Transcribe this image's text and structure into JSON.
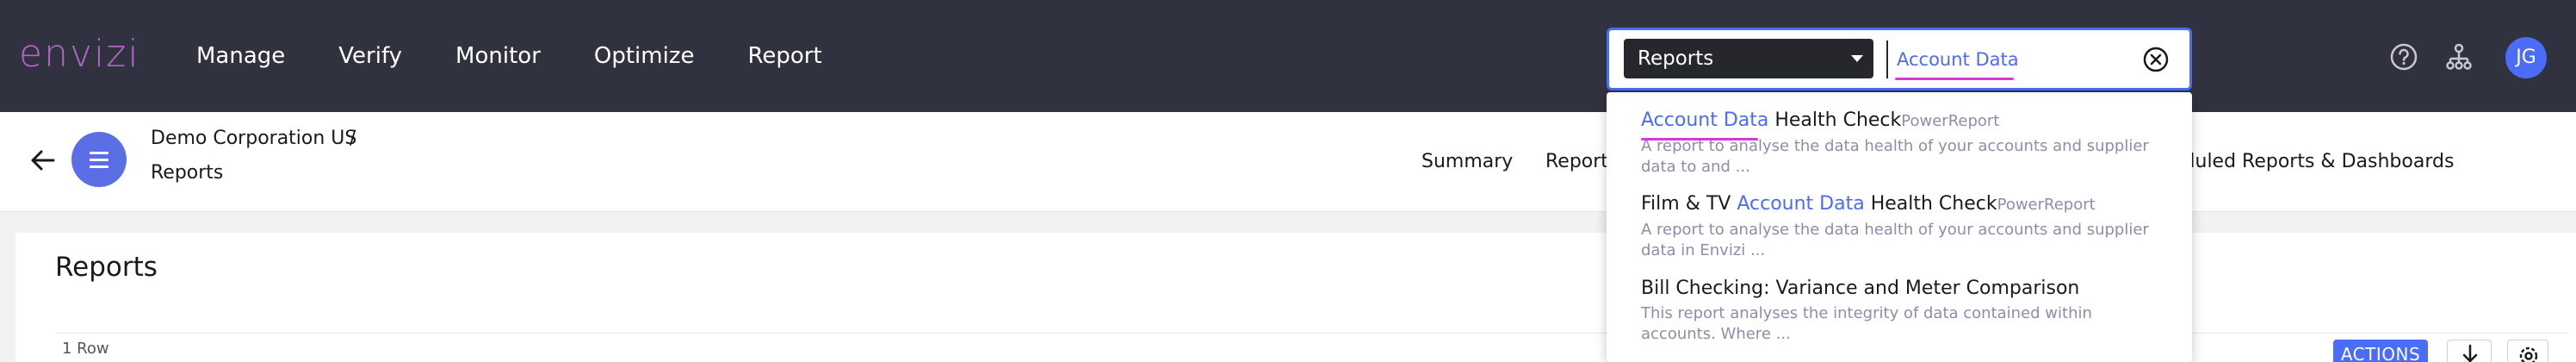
{
  "topbar": {
    "logo": "envizi",
    "nav": [
      "Manage",
      "Verify",
      "Monitor",
      "Optimize",
      "Report"
    ],
    "search": {
      "scope": "Reports",
      "query": "Account Data"
    },
    "avatar_initials": "JG",
    "icons": [
      "help-icon",
      "org-tree-icon",
      "clear-search-icon"
    ]
  },
  "subheader": {
    "organization": "Demo Corporation US",
    "separator": "/",
    "page": "Reports",
    "tabs": [
      "Summary",
      "Report",
      "eduled Reports & Dashboards"
    ]
  },
  "main": {
    "title": "Reports",
    "row_count": "1 Row",
    "actions_label": "ACTIONS"
  },
  "dropdown": {
    "results": [
      {
        "highlight": "Account Data",
        "rest": " Health Check",
        "tag": "PowerReport",
        "description": "A report to analyse the data health of your accounts and supplier data to and ..."
      },
      {
        "prefix": "Film & TV ",
        "highlight": "Account Data",
        "rest": " Health Check",
        "tag": "PowerReport",
        "description": "A report to analyse the data health of your accounts and supplier data in Envizi ..."
      },
      {
        "title": "Bill Checking: Variance and Meter Comparison",
        "description": "This report analyses the integrity of data contained within accounts. Where ..."
      }
    ]
  },
  "colors": {
    "topbar": "#31323f",
    "accent": "#4a6cf7",
    "logo": "#b266c8",
    "highlight_underline": "#d63ad6"
  }
}
